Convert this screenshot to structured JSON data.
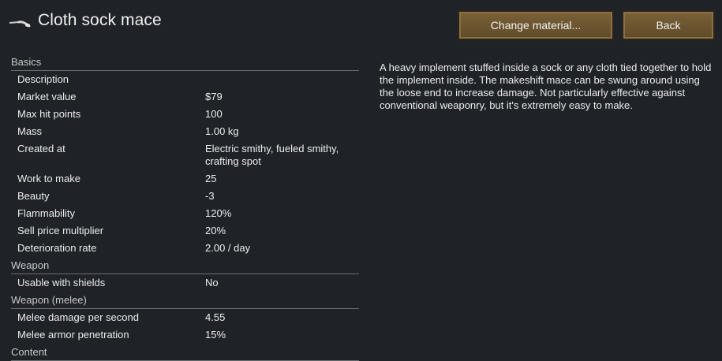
{
  "header": {
    "title": "Cloth sock mace",
    "icon": "mace-icon",
    "change_material_label": "Change material...",
    "back_label": "Back"
  },
  "sections": [
    {
      "title": "Basics",
      "rows": [
        {
          "label": "Description",
          "value": ""
        },
        {
          "label": "Market value",
          "value": "$79"
        },
        {
          "label": "Max hit points",
          "value": "100"
        },
        {
          "label": "Mass",
          "value": "1.00 kg"
        },
        {
          "label": "Created at",
          "value": "Electric smithy, fueled smithy, crafting spot"
        },
        {
          "label": "Work to make",
          "value": "25"
        },
        {
          "label": "Beauty",
          "value": "-3"
        },
        {
          "label": "Flammability",
          "value": "120%"
        },
        {
          "label": "Sell price multiplier",
          "value": "20%"
        },
        {
          "label": "Deterioration rate",
          "value": "2.00 / day"
        }
      ]
    },
    {
      "title": "Weapon",
      "rows": [
        {
          "label": "Usable with shields",
          "value": "No"
        }
      ]
    },
    {
      "title": "Weapon (melee)",
      "rows": [
        {
          "label": "Melee damage per second",
          "value": "4.55"
        },
        {
          "label": "Melee armor penetration",
          "value": "15%"
        }
      ]
    },
    {
      "title": "Content",
      "rows": []
    }
  ],
  "description": "A heavy implement stuffed inside a sock or any cloth tied together to hold the implement inside. The makeshift mace can be swung around using the loose end to increase damage. Not particularly effective against conventional weaponry, but it's extremely easy to make.",
  "colors": {
    "background": "#1f2327",
    "button": "#6b5531",
    "text": "#e6e6e6"
  }
}
